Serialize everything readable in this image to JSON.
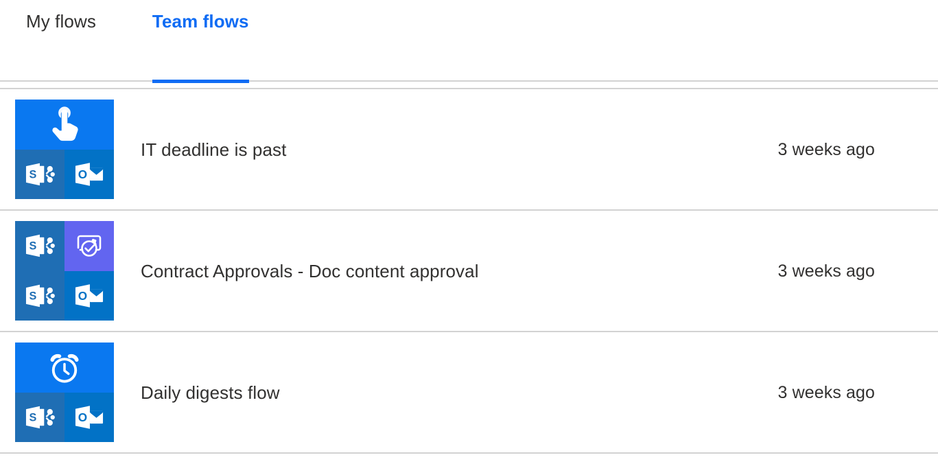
{
  "colors": {
    "accent": "#0f6cf4",
    "text": "#323130",
    "divider": "#d2d2d2",
    "trigger_tile": "#0a78f0",
    "sharepoint_tile": "#1f6eb4",
    "outlook_tile": "#0272c6",
    "approval_tile": "#6265f0"
  },
  "tabs": [
    {
      "id": "my-flows",
      "label": "My flows",
      "active": false
    },
    {
      "id": "team-flows",
      "label": "Team flows",
      "active": true
    }
  ],
  "flows": [
    {
      "name": "IT deadline is past",
      "modified": "3 weeks ago",
      "tile": {
        "layout": "full-top",
        "cells": [
          {
            "icon": "manual-trigger-icon",
            "bg": "bg-trigger",
            "span": "full"
          },
          {
            "icon": "sharepoint-icon",
            "bg": "bg-sharepoint",
            "span": "half"
          },
          {
            "icon": "outlook-icon",
            "bg": "bg-outlook",
            "span": "half"
          }
        ]
      }
    },
    {
      "name": "Contract Approvals - Doc content approval",
      "modified": "3 weeks ago",
      "tile": {
        "layout": "quad",
        "cells": [
          {
            "icon": "sharepoint-icon",
            "bg": "bg-sharepoint",
            "span": "half"
          },
          {
            "icon": "approvals-icon",
            "bg": "bg-approval",
            "span": "half"
          },
          {
            "icon": "sharepoint-icon",
            "bg": "bg-sharepoint",
            "span": "half"
          },
          {
            "icon": "outlook-icon",
            "bg": "bg-outlook",
            "span": "half"
          }
        ]
      }
    },
    {
      "name": "Daily digests flow",
      "modified": "3 weeks ago",
      "tile": {
        "layout": "full-top",
        "cells": [
          {
            "icon": "recurrence-clock-icon",
            "bg": "bg-trigger",
            "span": "full"
          },
          {
            "icon": "sharepoint-icon",
            "bg": "bg-sharepoint",
            "span": "half"
          },
          {
            "icon": "outlook-icon",
            "bg": "bg-outlook",
            "span": "half"
          }
        ]
      }
    }
  ]
}
